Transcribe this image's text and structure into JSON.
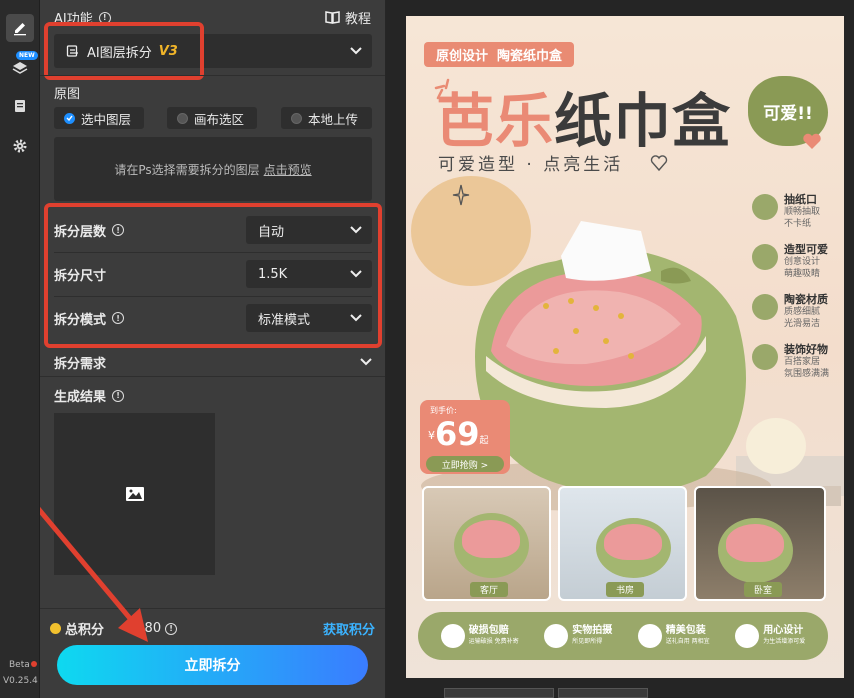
{
  "rail": {
    "items": [
      {
        "icon": "pencil-icon"
      },
      {
        "icon": "layers-icon",
        "badge": "NEW"
      },
      {
        "icon": "clipboard-icon"
      },
      {
        "icon": "gear-icon"
      }
    ],
    "beta": "Beta",
    "version": "V0.25.4"
  },
  "panel": {
    "ai_title": "AI功能",
    "tutorial": "教程",
    "feature": {
      "label": "AI图层拆分",
      "version": "V3"
    },
    "source": {
      "title": "原图",
      "options": [
        "选中图层",
        "画布选区",
        "本地上传"
      ],
      "hint": "请在Ps选择需要拆分的图层",
      "preview_link": "点击预览"
    },
    "params": [
      {
        "label": "拆分层数",
        "value": "自动"
      },
      {
        "label": "拆分尺寸",
        "value": "1.5K"
      },
      {
        "label": "拆分模式",
        "value": "标准模式"
      }
    ],
    "demand": "拆分需求",
    "result": {
      "title": "生成结果"
    },
    "points": {
      "label": "总积分",
      "value": "2080",
      "get": "获取积分"
    },
    "submit": "立即拆分"
  },
  "poster": {
    "tag": "原创设计  陶瓷纸巾盒",
    "title_a": "芭乐",
    "title_b": "纸巾盒",
    "cute": "可爱!!",
    "subtitle": "可爱造型 · 点亮生活",
    "features": [
      {
        "t": "抽纸口",
        "d1": "顺畅抽取",
        "d2": "不卡纸"
      },
      {
        "t": "造型可爱",
        "d1": "创意设计",
        "d2": "萌趣吸睛"
      },
      {
        "t": "陶瓷材质",
        "d1": "质感细腻",
        "d2": "光滑易洁"
      },
      {
        "t": "装饰好物",
        "d1": "百搭家居",
        "d2": "氛围感满满"
      }
    ],
    "price": {
      "label": "到手价:",
      "symbol": "¥",
      "value": "69",
      "unit": "起",
      "buy": "立即抢购 >"
    },
    "scenes": [
      "客厅",
      "书房",
      "卧室"
    ],
    "services": [
      {
        "t": "破损包赔",
        "d": "运输破损 免费补寄"
      },
      {
        "t": "实物拍摄",
        "d": "所见即所得"
      },
      {
        "t": "精美包装",
        "d": "送礼自用 两相宜"
      },
      {
        "t": "用心设计",
        "d": "为生活增添可爱"
      }
    ]
  },
  "colors": {
    "accent": "#e0402f",
    "blue": "#1e8fff",
    "olive": "#9aa86a",
    "salmon": "#ea8a75"
  }
}
